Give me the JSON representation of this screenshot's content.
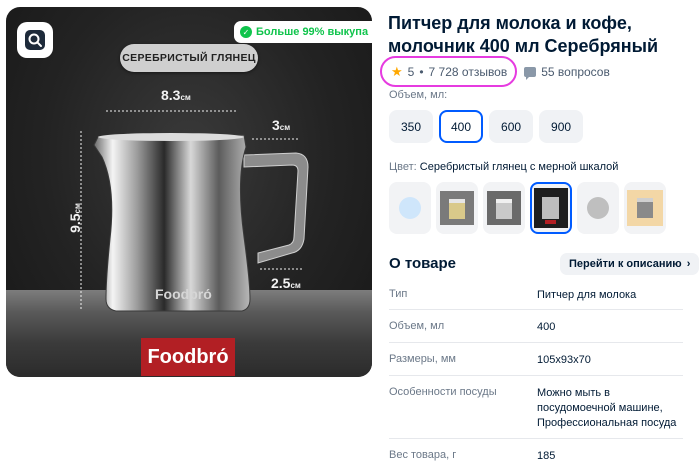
{
  "gallery": {
    "badge_text": "Больше 99% выкупа",
    "finish_label": "СЕРЕБРИСТЫЙ ГЛЯНЕЦ",
    "dim_width": "8.3",
    "dim_height": "9.5",
    "dim_spout": "3",
    "dim_base": "2.5",
    "dim_unit": "см",
    "brand_engraving": "Foodbrо́",
    "brand_box": "Foodbrо́"
  },
  "product": {
    "title": "Питчер для молока и кофе, молочник 400 мл Серебряный",
    "rating": "5",
    "reviews": "7 728 отзывов",
    "questions": "55 вопросов"
  },
  "volume": {
    "label": "Объем, мл:",
    "options": [
      "350",
      "400",
      "600",
      "900"
    ],
    "selected_index": 1
  },
  "color": {
    "label": "Цвет:",
    "value": "Серебристый глянец с мерной шкалой",
    "selected_index": 3
  },
  "about": {
    "title": "О товаре",
    "link": "Перейти к описанию",
    "specs": [
      {
        "key": "Тип",
        "value": "Питчер для молока"
      },
      {
        "key": "Объем, мл",
        "value": "400"
      },
      {
        "key": "Размеры, мм",
        "value": "105x93x70"
      },
      {
        "key": "Особенности посуды",
        "value": "Можно мыть в посудомоечной машине, Профессиональная посуда"
      },
      {
        "key": "Вес товара, г",
        "value": "185"
      }
    ]
  },
  "colors": {
    "accent": "#005bff",
    "badge_green": "#10c44c",
    "highlight_oval": "#e63be0",
    "star": "#ffa800",
    "brand_red": "#b21f24"
  }
}
